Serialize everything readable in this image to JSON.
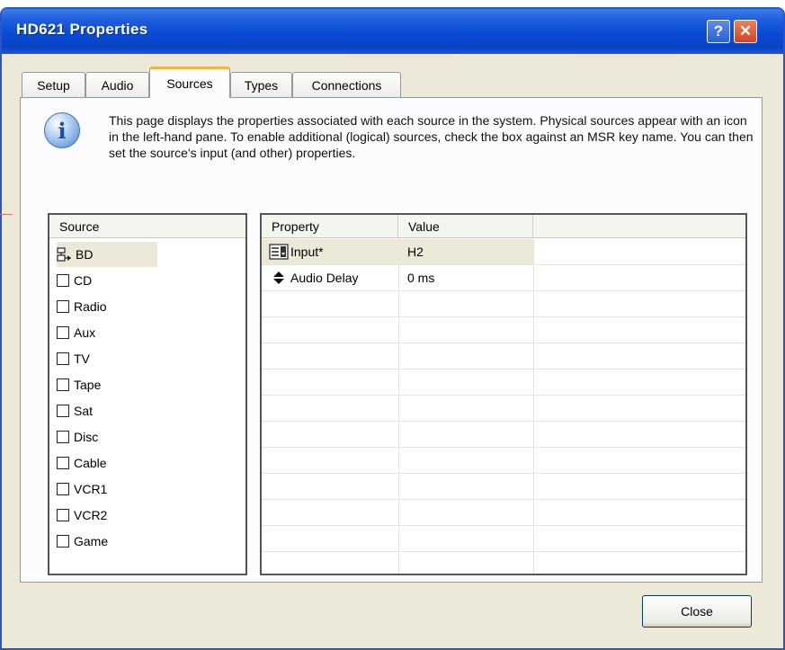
{
  "window": {
    "title": "HD621 Properties",
    "help_label": "?",
    "close_glyph": "✕"
  },
  "tabs": [
    {
      "label": "Setup",
      "active": false
    },
    {
      "label": "Audio",
      "active": false
    },
    {
      "label": "Sources",
      "active": true
    },
    {
      "label": "Types",
      "active": false
    },
    {
      "label": "Connections",
      "active": false
    }
  ],
  "description": "This page displays the properties associated with each source in the system. Physical sources appear with an icon in the left-hand pane. To enable additional (logical) sources, check the box against an MSR key name. You can then set the source's input (and other) properties.",
  "source_pane": {
    "header": "Source",
    "items": [
      {
        "label": "BD",
        "physical": true,
        "selected": true
      },
      {
        "label": "CD",
        "physical": false,
        "checked": false
      },
      {
        "label": "Radio",
        "physical": false,
        "checked": false
      },
      {
        "label": "Aux",
        "physical": false,
        "checked": false
      },
      {
        "label": "TV",
        "physical": false,
        "checked": false
      },
      {
        "label": "Tape",
        "physical": false,
        "checked": false
      },
      {
        "label": "Sat",
        "physical": false,
        "checked": false
      },
      {
        "label": "Disc",
        "physical": false,
        "checked": false
      },
      {
        "label": "Cable",
        "physical": false,
        "checked": false
      },
      {
        "label": "VCR1",
        "physical": false,
        "checked": false
      },
      {
        "label": "VCR2",
        "physical": false,
        "checked": false
      },
      {
        "label": "Game",
        "physical": false,
        "checked": false
      }
    ]
  },
  "property_pane": {
    "columns": [
      "Property",
      "Value"
    ],
    "rows": [
      {
        "name": "Input*",
        "value": "H2",
        "icon": "dropdown-list-icon",
        "selected": true
      },
      {
        "name": "Audio Delay",
        "value": "0 ms",
        "icon": "spinner-arrows-icon",
        "selected": false
      }
    ]
  },
  "buttons": {
    "close": "Close"
  },
  "colors": {
    "titlebar": "#0a4bd4",
    "dialog_bg": "#ece9d8",
    "active_tab_accent": "#f7b33e",
    "close_button_red": "#d2431b"
  }
}
